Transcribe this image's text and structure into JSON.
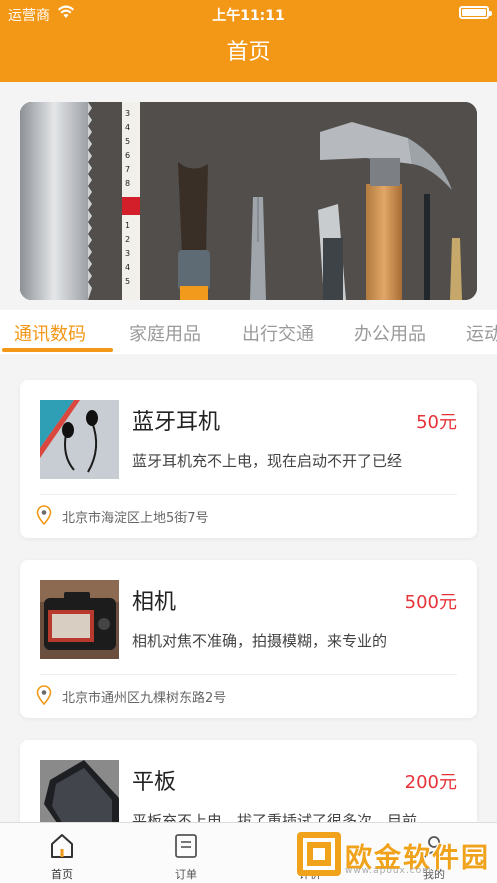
{
  "status_bar": {
    "carrier": "运营商",
    "time": "上午11:11"
  },
  "header": {
    "title": "首页"
  },
  "categories": [
    {
      "label": "通讯数码",
      "active": true
    },
    {
      "label": "家庭用品",
      "active": false
    },
    {
      "label": "出行交通",
      "active": false
    },
    {
      "label": "办公用品",
      "active": false
    },
    {
      "label": "运动",
      "active": false
    }
  ],
  "listings": [
    {
      "title": "蓝牙耳机",
      "price": "50元",
      "description": "蓝牙耳机充不上电，现在启动不开了已经",
      "address": "北京市海淀区上地5街7号",
      "thumb": "earphones-photo"
    },
    {
      "title": "相机",
      "price": "500元",
      "description": "相机对焦不准确，拍摄模糊，来专业的",
      "address": "北京市通州区九棵树东路2号",
      "thumb": "camera-photo"
    },
    {
      "title": "平板",
      "price": "200元",
      "description": "平板充不上电，拔了重插试了很多次，目前...",
      "address": "",
      "thumb": "tablet-photo"
    }
  ],
  "tabbar": [
    {
      "label": "首页",
      "icon": "home-icon"
    },
    {
      "label": "订单",
      "icon": "orders-icon"
    },
    {
      "label": "评价",
      "icon": "review-icon"
    },
    {
      "label": "我的",
      "icon": "profile-icon"
    }
  ],
  "watermark": {
    "text": "欧金软件园",
    "sub": "www.apoux.com"
  },
  "colors": {
    "accent": "#f39716",
    "price": "#e8323a"
  }
}
